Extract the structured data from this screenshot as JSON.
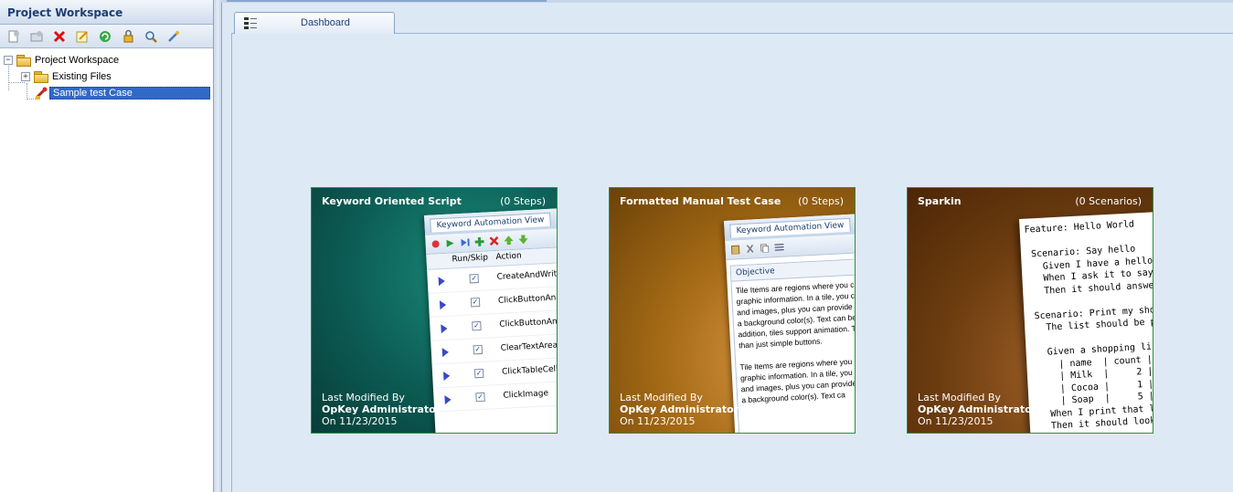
{
  "panel": {
    "title": "Project Workspace",
    "toolbar": [
      "new-file-icon",
      "new-folder-icon",
      "delete-icon",
      "edit-icon",
      "refresh-icon",
      "lock-icon",
      "search-icon",
      "tools-icon"
    ]
  },
  "tree": {
    "root": "Project Workspace",
    "children": [
      "Existing Files",
      "Sample test Case"
    ]
  },
  "tab": {
    "label": "Dashboard"
  },
  "tiles": [
    {
      "title": "Keyword Oriented Script",
      "count": "(0 Steps)",
      "modified_label": "Last Modified By",
      "modified_by": "OpKey Administrator",
      "modified_on": "On 11/23/2015",
      "bg": "#0f5f57",
      "preview": {
        "tab": "Keyword Automation View",
        "col_run": "Run/Skip",
        "col_action": "Action",
        "actions": [
          "CreateAndWriteInTextFile",
          "ClickButtonAndWait",
          "ClickButtonAndWait",
          "ClearTextArea",
          "ClickTableCell",
          "ClickImage"
        ]
      }
    },
    {
      "title": "Formatted Manual Test Case",
      "count": "(0 Steps)",
      "modified_label": "Last Modified By",
      "modified_by": "OpKey Administrator",
      "modified_on": "On 11/23/2015",
      "bg": "#9a6a18",
      "preview": {
        "tab": "Keyword Automation View",
        "section": "Objective",
        "text": "Tile Items are regions where you can graphic information. In a tile, you can and images, plus you can provide a b a background color(s). Text can be f addition, tiles support animation. This than just simple buttons.\n\nTile Items are regions where you can graphic information. In a tile, you can and images, plus you can provide a b a background color(s). Text ca"
      }
    },
    {
      "title": "Sparkin",
      "count": "(0 Scenarios)",
      "modified_label": "Last Modified By",
      "modified_by": "OpKey Administrator",
      "modified_on": "On 11/23/2015",
      "bg": "#6e3d10",
      "preview": {
        "code": "Feature: Hello World\n\n Scenario: Say hello\n   Given I have a hello app\n   When I ask it to say hi\n   Then it should answer with\n\n Scenario: Print my shopping list\n   The list should be printed\n\n   Given a shopping list:\n     | name  | count |\n     | Milk  |     2 |\n     | Cocoa |     1 |\n     | Soap  |     5 |\n   When I print that list\n   Then it should look like"
      }
    }
  ]
}
